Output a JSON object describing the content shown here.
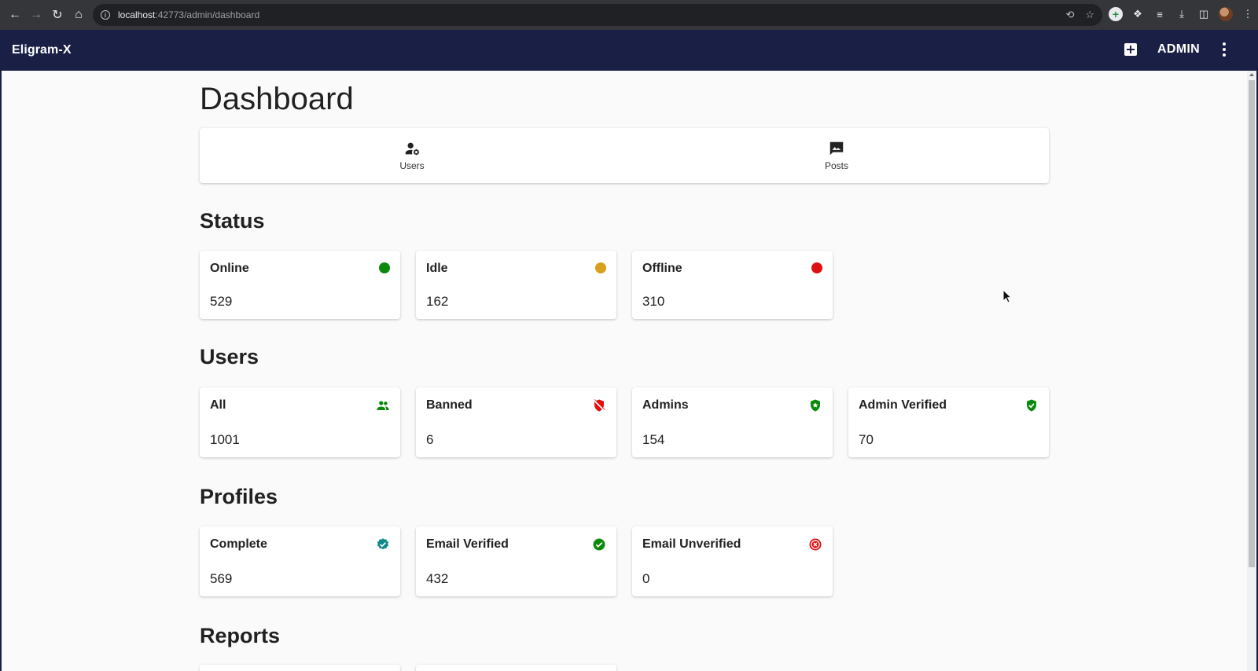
{
  "browser": {
    "url_host": "localhost",
    "url_path": ":42773/admin/dashboard"
  },
  "app_bar": {
    "title": "Eligram-X",
    "user_label": "ADMIN"
  },
  "page": {
    "title": "Dashboard"
  },
  "tabs": [
    {
      "label": "Users",
      "icon": "manage-accounts-icon"
    },
    {
      "label": "Posts",
      "icon": "image-message-icon"
    }
  ],
  "sections": {
    "status": {
      "title": "Status",
      "cards": [
        {
          "label": "Online",
          "value": "529",
          "icon": "status-dot",
          "color": "#0a8a0a"
        },
        {
          "label": "Idle",
          "value": "162",
          "icon": "status-dot",
          "color": "#d9a01b"
        },
        {
          "label": "Offline",
          "value": "310",
          "icon": "status-dot",
          "color": "#e01010"
        }
      ]
    },
    "users": {
      "title": "Users",
      "cards": [
        {
          "label": "All",
          "value": "1001",
          "icon": "group-icon",
          "color": "#0a8a0a"
        },
        {
          "label": "Banned",
          "value": "6",
          "icon": "shield-off-icon",
          "color": "#e01010"
        },
        {
          "label": "Admins",
          "value": "154",
          "icon": "shield-star-icon",
          "color": "#0a8a0a"
        },
        {
          "label": "Admin Verified",
          "value": "70",
          "icon": "shield-check-icon",
          "color": "#0a8a0a"
        }
      ]
    },
    "profiles": {
      "title": "Profiles",
      "cards": [
        {
          "label": "Complete",
          "value": "569",
          "icon": "verified-badge-icon",
          "color": "#0f8a8a"
        },
        {
          "label": "Email Verified",
          "value": "432",
          "icon": "check-circle-icon",
          "color": "#0a8a0a"
        },
        {
          "label": "Email Unverified",
          "value": "0",
          "icon": "x-circle-icon",
          "color": "#e01010"
        }
      ]
    },
    "reports": {
      "title": "Reports"
    }
  }
}
